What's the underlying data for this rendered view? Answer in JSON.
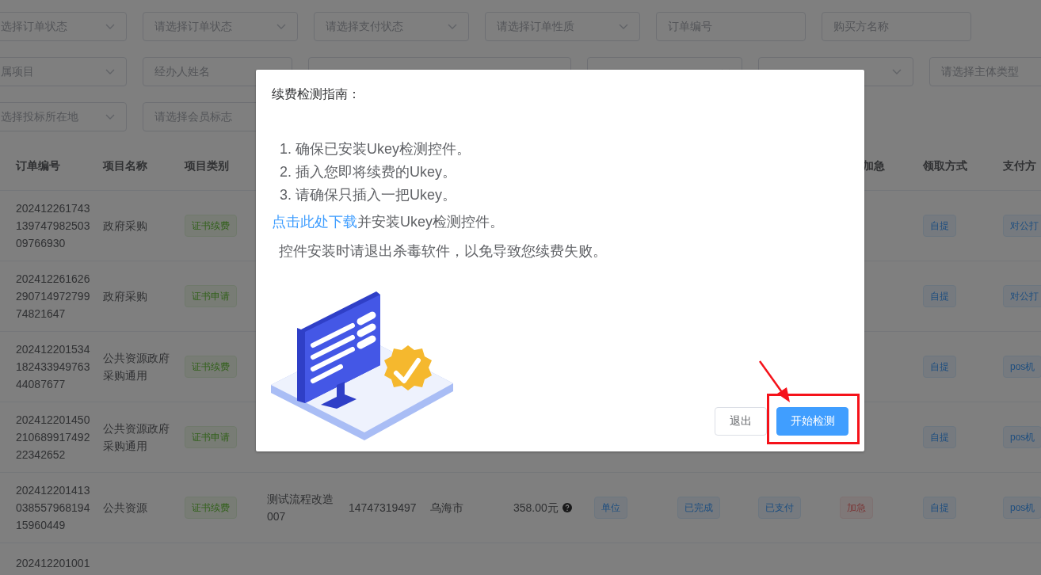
{
  "filters": [
    [
      {
        "kind": "select",
        "placeholder": "选择订单状态"
      },
      {
        "kind": "select",
        "placeholder": "请选择订单状态"
      },
      {
        "kind": "select",
        "placeholder": "请选择支付状态"
      },
      {
        "kind": "select",
        "placeholder": "请选择订单性质"
      },
      {
        "kind": "input",
        "placeholder": "订单编号"
      },
      {
        "kind": "input",
        "placeholder": "购买方名称"
      }
    ],
    [
      {
        "kind": "select",
        "placeholder": "属项目"
      },
      {
        "kind": "input",
        "placeholder": "经办人姓名"
      },
      {
        "kind": "range"
      },
      {
        "kind": "select"
      },
      {
        "kind": "select"
      },
      {
        "kind": "input",
        "placeholder": "请选择主体类型"
      }
    ],
    [
      {
        "kind": "select",
        "placeholder": "选择投标所在地"
      },
      {
        "kind": "input",
        "placeholder": "请选择会员标志"
      }
    ]
  ],
  "table": {
    "header": {
      "order_no": "订单编号",
      "project_name": "项目名称",
      "project_category": "项目类别",
      "urgent": "加急",
      "pickup": "领取方式",
      "payment": "支付方"
    },
    "rows": [
      {
        "order_no": "20241226174313974798250309766930",
        "project_name": "政府采购",
        "project_category": {
          "kind": "success",
          "text": "证书续费"
        },
        "pickup": {
          "kind": "info",
          "text": "自提"
        },
        "payment": {
          "kind": "info",
          "text": "对公打"
        }
      },
      {
        "order_no": "20241226162629071497279974821647",
        "project_name": "政府采购",
        "project_category": {
          "kind": "success",
          "text": "证书申请"
        },
        "pickup": {
          "kind": "info",
          "text": "自提"
        },
        "payment": {
          "kind": "info",
          "text": "对公打"
        }
      },
      {
        "order_no": "20241220153418243394976344087677",
        "project_name": "公共资源政府采购通用",
        "project_category": {
          "kind": "success",
          "text": "证书续费"
        },
        "pickup": {
          "kind": "info",
          "text": "自提"
        },
        "payment": {
          "kind": "info",
          "text": "pos机"
        }
      },
      {
        "order_no": "20241220145021068991749222342652",
        "project_name": "公共资源政府采购通用",
        "project_category": {
          "kind": "success",
          "text": "证书申请"
        },
        "pickup": {
          "kind": "info",
          "text": "自提"
        },
        "payment": {
          "kind": "info",
          "text": "pos机"
        }
      },
      {
        "order_no": "20241220141303855796819415960449",
        "project_name": "公共资源",
        "project_category": {
          "kind": "success",
          "text": "证书续费"
        },
        "column_4": "测试流程改造007",
        "column_5": "14747319497",
        "column_6": "乌海市",
        "column_7": "358.00元",
        "column_8": {
          "kind": "info",
          "text": "单位"
        },
        "column_9": {
          "kind": "info",
          "text": "已完成"
        },
        "column_10": {
          "kind": "info",
          "text": "已支付"
        },
        "urgent": {
          "kind": "danger",
          "text": "加急"
        },
        "pickup": {
          "kind": "info",
          "text": "自提"
        },
        "payment": {
          "kind": "info",
          "text": "pos机"
        }
      },
      {
        "order_no": "202412201001"
      }
    ]
  },
  "dialog": {
    "title": "续费检测指南：",
    "steps": [
      "1. 确保已安装Ukey检测控件。",
      "2. 插入您即将续费的Ukey。",
      "3. 请确保只插入一把Ukey。"
    ],
    "download": {
      "link": "点击此处下载",
      "text": "并安装Ukey检测控件。"
    },
    "notice": "控件安装时请退出杀毒软件，以免导致您续费失败。",
    "buttons": [
      {
        "kind": "default",
        "label": "退出"
      },
      {
        "kind": "primary",
        "label": "开始检测",
        "highlighted": true
      }
    ]
  }
}
